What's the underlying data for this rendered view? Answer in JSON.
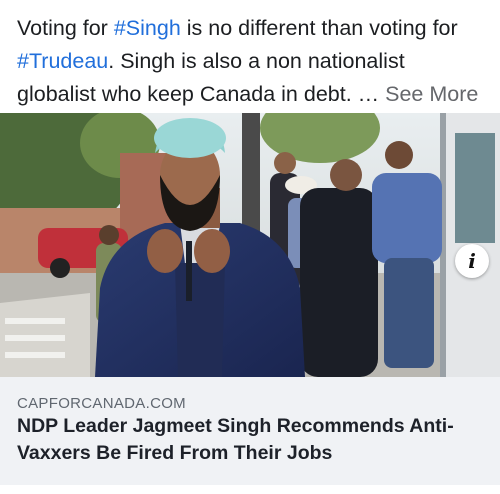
{
  "post": {
    "text_part1": "Voting for ",
    "hashtag1": "#Singh",
    "text_part2": " is no different than voting for ",
    "hashtag2": "#Trudeau",
    "text_part3": ". Singh is also a non nationalist globalist who keep Canada in debt. … ",
    "see_more": "See More"
  },
  "image": {
    "info_icon": "i"
  },
  "link": {
    "domain": "CAPFORCANADA.COM",
    "title": "NDP Leader Jagmeet Singh Recommends Anti-Vaxxers Be Fired From Their Jobs"
  },
  "colors": {
    "hashtag": "#216fdb",
    "card_bg": "#f0f2f5",
    "text": "#1c1e21"
  }
}
